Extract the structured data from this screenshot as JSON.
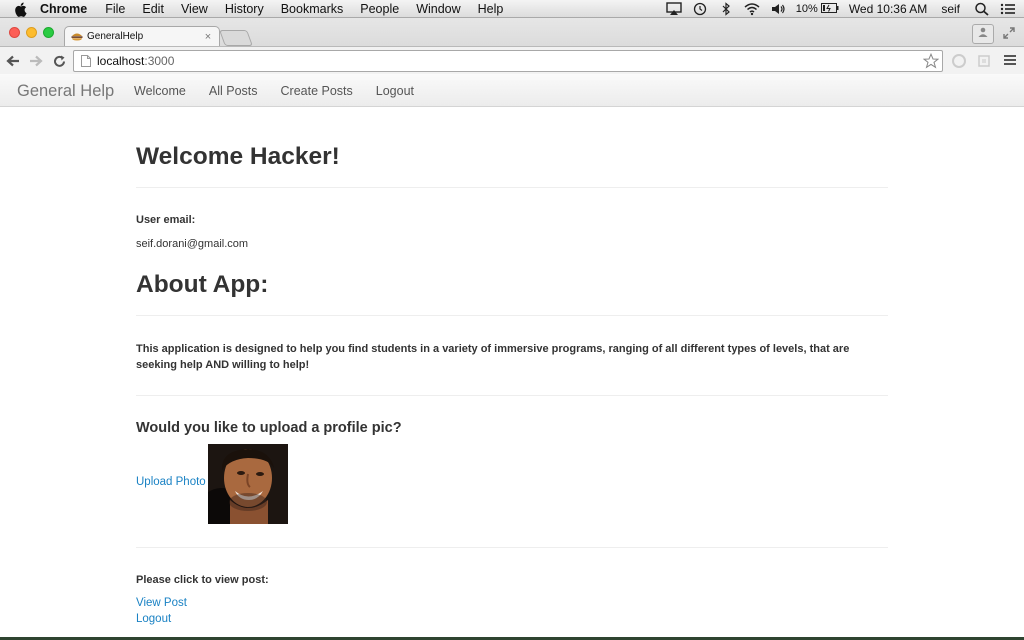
{
  "menubar": {
    "app": "Chrome",
    "items": [
      "File",
      "Edit",
      "View",
      "History",
      "Bookmarks",
      "People",
      "Window",
      "Help"
    ],
    "battery": "10%",
    "clock": "Wed 10:36 AM",
    "user": "seif"
  },
  "browser": {
    "tab_title": "GeneralHelp",
    "tab_close": "×",
    "url_host": "localhost",
    "url_port": ":3000"
  },
  "navbar": {
    "brand": "General Help",
    "links": [
      "Welcome",
      "All Posts",
      "Create Posts",
      "Logout"
    ]
  },
  "main": {
    "welcome_heading": "Welcome Hacker!",
    "email_label": "User email:",
    "email_value": "seif.dorani@gmail.com",
    "about_heading": "About App:",
    "about_text": "This application is designed to help you find students in a variety of immersive programs, ranging of all different types of levels, that are seeking help AND willing to help!",
    "upload_heading": "Would you like to upload a profile pic?",
    "upload_link": "Upload Photo",
    "view_label": "Please click to view post:",
    "view_post_link": "View Post",
    "logout_link": "Logout"
  },
  "colors": {
    "link": "#1a82c4",
    "text": "#333333",
    "navbar_text": "#777777"
  }
}
